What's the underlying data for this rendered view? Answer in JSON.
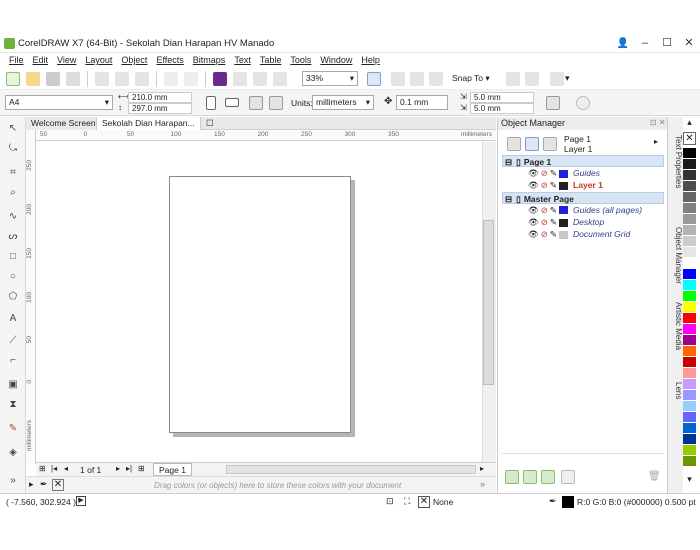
{
  "app": {
    "title": "CorelDRAW X7 (64-Bit) - Sekolah Dian Harapan HV Manado"
  },
  "window": {
    "minimize": "–",
    "maximize": "☐",
    "close": "✕"
  },
  "menu": [
    "File",
    "Edit",
    "View",
    "Layout",
    "Object",
    "Effects",
    "Bitmaps",
    "Text",
    "Table",
    "Tools",
    "Window",
    "Help"
  ],
  "toolbar": {
    "zoom": "33%",
    "snap_to": "Snap To"
  },
  "property_bar": {
    "page_size": "A4",
    "width": "210.0 mm",
    "height": "297.0 mm",
    "units_label": "Units:",
    "units_value": "millimeters",
    "nudge": "0.1 mm",
    "dup_x": "5.0 mm",
    "dup_y": "5.0 mm"
  },
  "doc_tabs": [
    "Welcome Screen",
    "Sekolah Dian Harapan..."
  ],
  "ruler": {
    "h_ticks": [
      "50",
      "0",
      "50",
      "100",
      "150",
      "200",
      "250",
      "300",
      "350"
    ],
    "h_unit": "millimeters",
    "v_ticks": [
      "250",
      "200",
      "150",
      "100",
      "50",
      "0"
    ],
    "v_unit": "millimeters"
  },
  "page_nav": {
    "counter": "1 of 1",
    "page_tab": "Page 1"
  },
  "palette_bar": {
    "hint": "Drag colors (or objects) here to store these colors with your document"
  },
  "object_manager": {
    "title": "Object Manager",
    "current_page": "Page 1",
    "current_layer": "Layer 1",
    "tree": [
      {
        "type": "page",
        "label": "Page 1"
      },
      {
        "type": "item",
        "label": "Guides",
        "color": "#1f1fe0"
      },
      {
        "type": "item",
        "label": "Layer 1",
        "color": "#222222",
        "active": true
      },
      {
        "type": "page",
        "label": "Master Page"
      },
      {
        "type": "item",
        "label": "Guides (all pages)",
        "color": "#1f1fe0"
      },
      {
        "type": "item",
        "label": "Desktop",
        "color": "#222222"
      },
      {
        "type": "item",
        "label": "Document Grid",
        "color": "#c8c8c8"
      }
    ]
  },
  "dockers": [
    "Text Properties",
    "Object Manager",
    "Artistic Media",
    "Lens"
  ],
  "palette_colors": [
    "#000000",
    "#1a1a1a",
    "#333333",
    "#4d4d4d",
    "#666666",
    "#808080",
    "#999999",
    "#b3b3b3",
    "#cccccc",
    "#e6e6e6",
    "#ffffff",
    "#0000ff",
    "#00ffff",
    "#00ff00",
    "#ffff00",
    "#ff0000",
    "#ff00ff",
    "#a0008c",
    "#ff6600",
    "#c80000",
    "#ff9999",
    "#cc99ff",
    "#9999ff",
    "#99ccff",
    "#6666ff",
    "#0066cc",
    "#003399",
    "#99cc00",
    "#669900"
  ],
  "status": {
    "coords": "( -7.560, 302.924 )",
    "fill_none": "None",
    "outline": "R:0 G:0 B:0 (#000000)  0.500 pt"
  }
}
